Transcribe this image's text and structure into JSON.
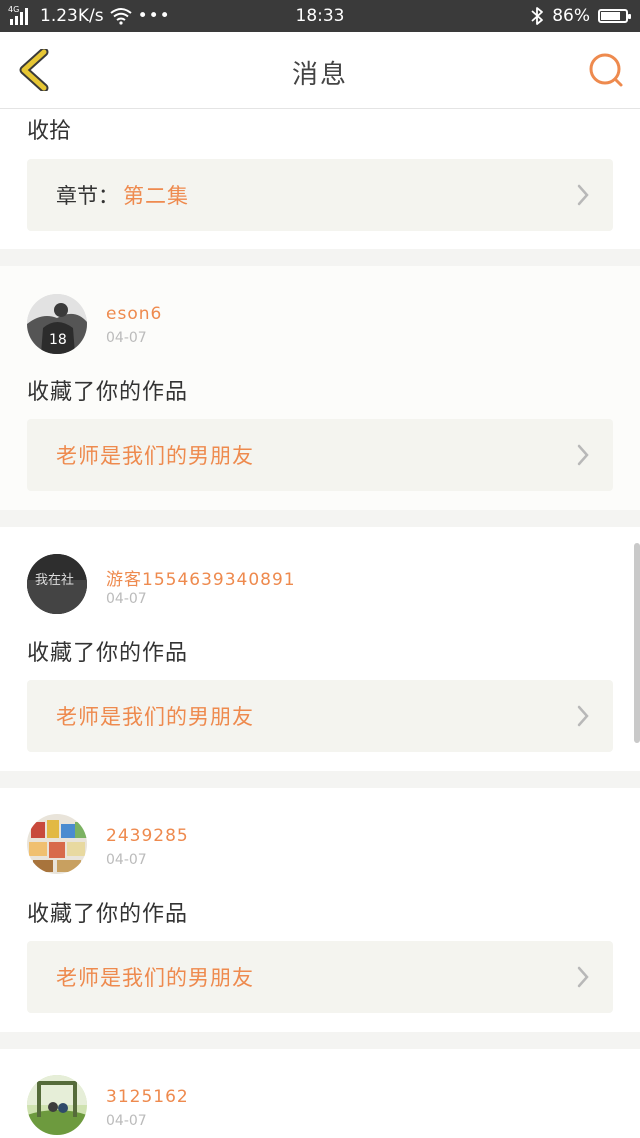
{
  "status_bar": {
    "network_type": "4G",
    "speed": "1.23K/s",
    "more": "•••",
    "time": "18:33",
    "battery_text": "86%",
    "battery_level": 0.86
  },
  "header": {
    "title": "消息"
  },
  "top_item": {
    "fragment": "收拾",
    "chapter_label": "章节：",
    "chapter_value": "第二集"
  },
  "messages": [
    {
      "username": "eson6",
      "date": "04-07",
      "action": "收藏了你的作品",
      "work_title": "老师是我们的男朋友",
      "avatar_text": "18"
    },
    {
      "username": "游客1554639340891",
      "date": "04-07",
      "action": "收藏了你的作品",
      "work_title": "老师是我们的男朋友",
      "avatar_text": "我在社"
    },
    {
      "username": "2439285",
      "date": "04-07",
      "action": "收藏了你的作品",
      "work_title": "老师是我们的男朋友"
    },
    {
      "username": "3125162",
      "date": "04-07"
    }
  ],
  "colors": {
    "accent": "#ee8a4e",
    "back_arrow": "#e6c634",
    "status_bar": "#3a3a3a"
  }
}
